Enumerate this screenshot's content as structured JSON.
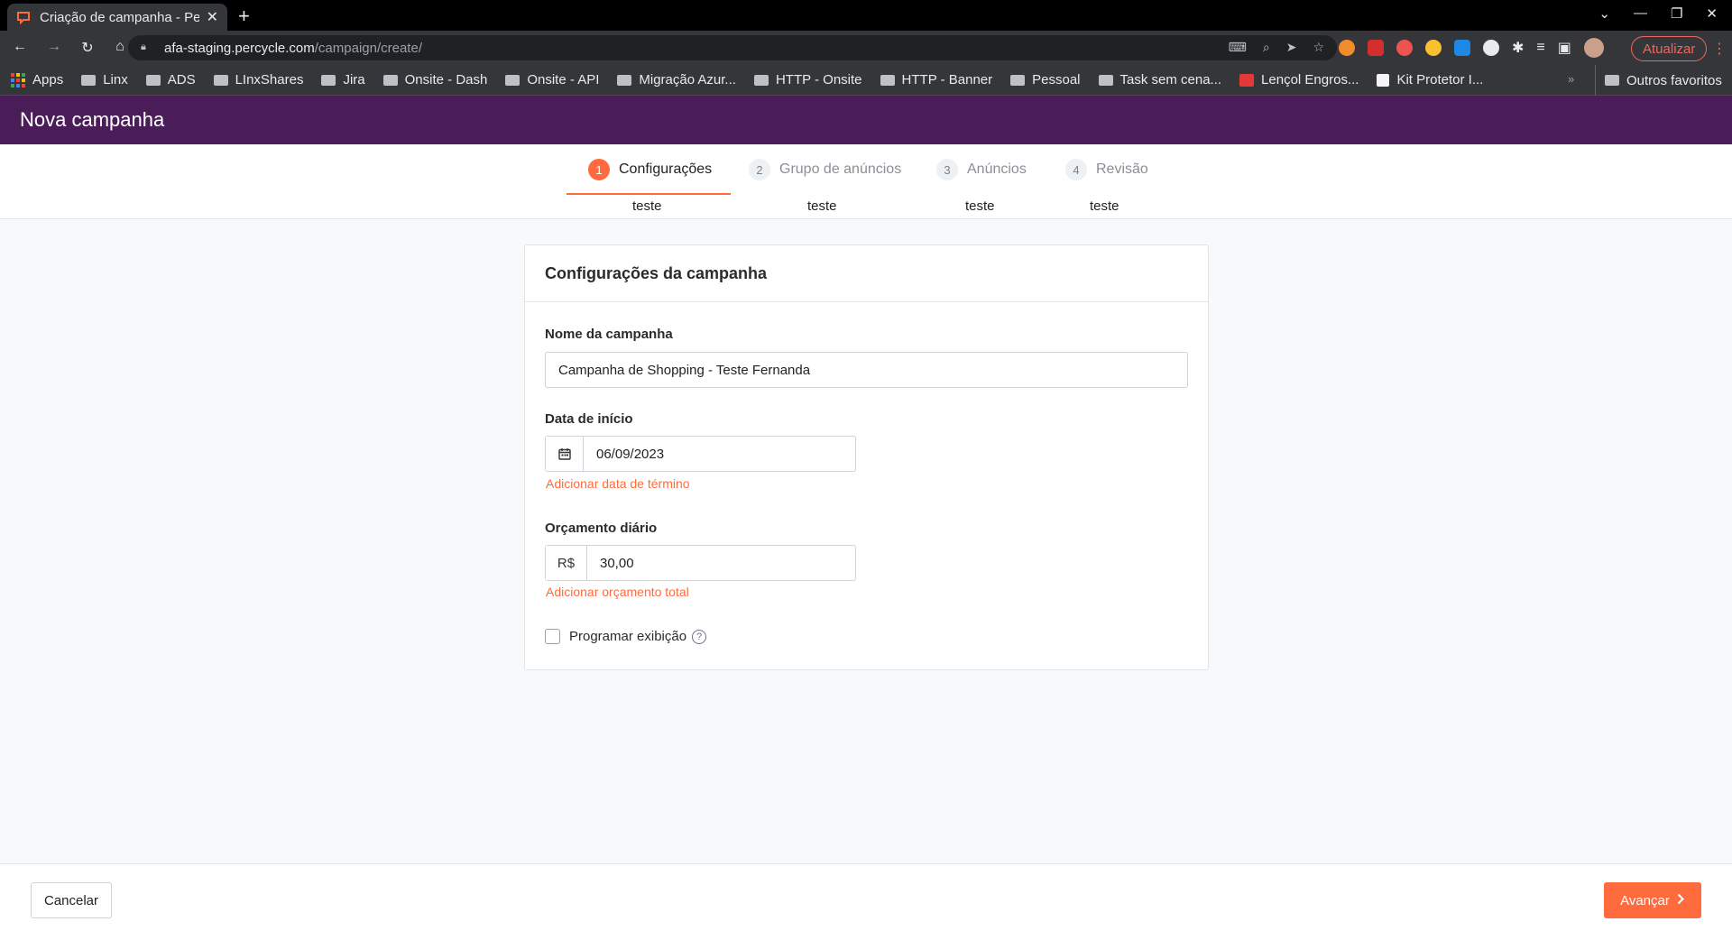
{
  "browser": {
    "tab_title": "Criação de campanha - Pe",
    "url_host": "afa-staging.percycle.com",
    "url_path": "/campaign/create/",
    "update_label": "Atualizar",
    "bookmarks": [
      "Apps",
      "Linx",
      "ADS",
      "LInxShares",
      "Jira",
      "Onsite - Dash",
      "Onsite - API",
      "Migração Azur...",
      "HTTP - Onsite",
      "HTTP - Banner",
      "Pessoal",
      "Task sem cena...",
      "Lençol Engros...",
      "Kit Protetor I..."
    ],
    "other_bookmarks": "Outros favoritos"
  },
  "header": {
    "title": "Nova campanha"
  },
  "steps": [
    {
      "num": "1",
      "label": "Configurações",
      "sub": "teste"
    },
    {
      "num": "2",
      "label": "Grupo de anúncios",
      "sub": "teste"
    },
    {
      "num": "3",
      "label": "Anúncios",
      "sub": "teste"
    },
    {
      "num": "4",
      "label": "Revisão",
      "sub": "teste"
    }
  ],
  "form": {
    "title": "Configurações da campanha",
    "name_label": "Nome da campanha",
    "name_value": "Campanha de Shopping - Teste Fernanda",
    "start_label": "Data de início",
    "start_value": "06/09/2023",
    "add_end_date": "Adicionar data de término",
    "budget_label": "Orçamento diário",
    "currency": "R$",
    "budget_value": "30,00",
    "add_total_budget": "Adicionar orçamento total",
    "schedule_label": "Programar exibição"
  },
  "footer": {
    "cancel": "Cancelar",
    "next": "Avançar"
  },
  "colors": {
    "accent": "#ff6b3d",
    "header_bg": "#4b1d58"
  }
}
